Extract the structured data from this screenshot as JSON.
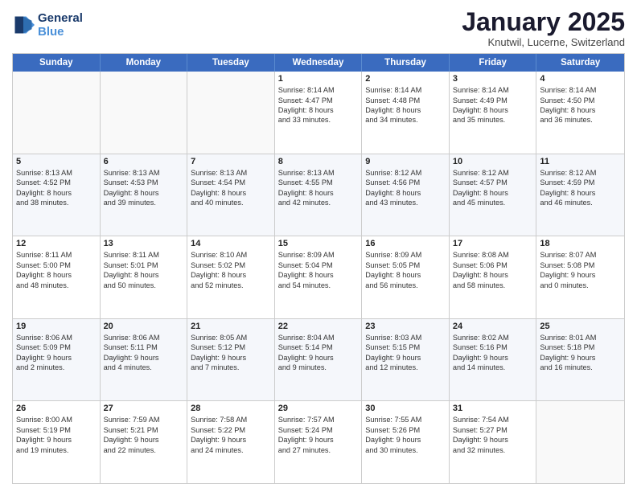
{
  "logo": {
    "line1": "General",
    "line2": "Blue"
  },
  "title": "January 2025",
  "subtitle": "Knutwil, Lucerne, Switzerland",
  "header_days": [
    "Sunday",
    "Monday",
    "Tuesday",
    "Wednesday",
    "Thursday",
    "Friday",
    "Saturday"
  ],
  "weeks": [
    [
      {
        "day": "",
        "lines": []
      },
      {
        "day": "",
        "lines": []
      },
      {
        "day": "",
        "lines": []
      },
      {
        "day": "1",
        "lines": [
          "Sunrise: 8:14 AM",
          "Sunset: 4:47 PM",
          "Daylight: 8 hours",
          "and 33 minutes."
        ]
      },
      {
        "day": "2",
        "lines": [
          "Sunrise: 8:14 AM",
          "Sunset: 4:48 PM",
          "Daylight: 8 hours",
          "and 34 minutes."
        ]
      },
      {
        "day": "3",
        "lines": [
          "Sunrise: 8:14 AM",
          "Sunset: 4:49 PM",
          "Daylight: 8 hours",
          "and 35 minutes."
        ]
      },
      {
        "day": "4",
        "lines": [
          "Sunrise: 8:14 AM",
          "Sunset: 4:50 PM",
          "Daylight: 8 hours",
          "and 36 minutes."
        ]
      }
    ],
    [
      {
        "day": "5",
        "lines": [
          "Sunrise: 8:13 AM",
          "Sunset: 4:52 PM",
          "Daylight: 8 hours",
          "and 38 minutes."
        ]
      },
      {
        "day": "6",
        "lines": [
          "Sunrise: 8:13 AM",
          "Sunset: 4:53 PM",
          "Daylight: 8 hours",
          "and 39 minutes."
        ]
      },
      {
        "day": "7",
        "lines": [
          "Sunrise: 8:13 AM",
          "Sunset: 4:54 PM",
          "Daylight: 8 hours",
          "and 40 minutes."
        ]
      },
      {
        "day": "8",
        "lines": [
          "Sunrise: 8:13 AM",
          "Sunset: 4:55 PM",
          "Daylight: 8 hours",
          "and 42 minutes."
        ]
      },
      {
        "day": "9",
        "lines": [
          "Sunrise: 8:12 AM",
          "Sunset: 4:56 PM",
          "Daylight: 8 hours",
          "and 43 minutes."
        ]
      },
      {
        "day": "10",
        "lines": [
          "Sunrise: 8:12 AM",
          "Sunset: 4:57 PM",
          "Daylight: 8 hours",
          "and 45 minutes."
        ]
      },
      {
        "day": "11",
        "lines": [
          "Sunrise: 8:12 AM",
          "Sunset: 4:59 PM",
          "Daylight: 8 hours",
          "and 46 minutes."
        ]
      }
    ],
    [
      {
        "day": "12",
        "lines": [
          "Sunrise: 8:11 AM",
          "Sunset: 5:00 PM",
          "Daylight: 8 hours",
          "and 48 minutes."
        ]
      },
      {
        "day": "13",
        "lines": [
          "Sunrise: 8:11 AM",
          "Sunset: 5:01 PM",
          "Daylight: 8 hours",
          "and 50 minutes."
        ]
      },
      {
        "day": "14",
        "lines": [
          "Sunrise: 8:10 AM",
          "Sunset: 5:02 PM",
          "Daylight: 8 hours",
          "and 52 minutes."
        ]
      },
      {
        "day": "15",
        "lines": [
          "Sunrise: 8:09 AM",
          "Sunset: 5:04 PM",
          "Daylight: 8 hours",
          "and 54 minutes."
        ]
      },
      {
        "day": "16",
        "lines": [
          "Sunrise: 8:09 AM",
          "Sunset: 5:05 PM",
          "Daylight: 8 hours",
          "and 56 minutes."
        ]
      },
      {
        "day": "17",
        "lines": [
          "Sunrise: 8:08 AM",
          "Sunset: 5:06 PM",
          "Daylight: 8 hours",
          "and 58 minutes."
        ]
      },
      {
        "day": "18",
        "lines": [
          "Sunrise: 8:07 AM",
          "Sunset: 5:08 PM",
          "Daylight: 9 hours",
          "and 0 minutes."
        ]
      }
    ],
    [
      {
        "day": "19",
        "lines": [
          "Sunrise: 8:06 AM",
          "Sunset: 5:09 PM",
          "Daylight: 9 hours",
          "and 2 minutes."
        ]
      },
      {
        "day": "20",
        "lines": [
          "Sunrise: 8:06 AM",
          "Sunset: 5:11 PM",
          "Daylight: 9 hours",
          "and 4 minutes."
        ]
      },
      {
        "day": "21",
        "lines": [
          "Sunrise: 8:05 AM",
          "Sunset: 5:12 PM",
          "Daylight: 9 hours",
          "and 7 minutes."
        ]
      },
      {
        "day": "22",
        "lines": [
          "Sunrise: 8:04 AM",
          "Sunset: 5:14 PM",
          "Daylight: 9 hours",
          "and 9 minutes."
        ]
      },
      {
        "day": "23",
        "lines": [
          "Sunrise: 8:03 AM",
          "Sunset: 5:15 PM",
          "Daylight: 9 hours",
          "and 12 minutes."
        ]
      },
      {
        "day": "24",
        "lines": [
          "Sunrise: 8:02 AM",
          "Sunset: 5:16 PM",
          "Daylight: 9 hours",
          "and 14 minutes."
        ]
      },
      {
        "day": "25",
        "lines": [
          "Sunrise: 8:01 AM",
          "Sunset: 5:18 PM",
          "Daylight: 9 hours",
          "and 16 minutes."
        ]
      }
    ],
    [
      {
        "day": "26",
        "lines": [
          "Sunrise: 8:00 AM",
          "Sunset: 5:19 PM",
          "Daylight: 9 hours",
          "and 19 minutes."
        ]
      },
      {
        "day": "27",
        "lines": [
          "Sunrise: 7:59 AM",
          "Sunset: 5:21 PM",
          "Daylight: 9 hours",
          "and 22 minutes."
        ]
      },
      {
        "day": "28",
        "lines": [
          "Sunrise: 7:58 AM",
          "Sunset: 5:22 PM",
          "Daylight: 9 hours",
          "and 24 minutes."
        ]
      },
      {
        "day": "29",
        "lines": [
          "Sunrise: 7:57 AM",
          "Sunset: 5:24 PM",
          "Daylight: 9 hours",
          "and 27 minutes."
        ]
      },
      {
        "day": "30",
        "lines": [
          "Sunrise: 7:55 AM",
          "Sunset: 5:26 PM",
          "Daylight: 9 hours",
          "and 30 minutes."
        ]
      },
      {
        "day": "31",
        "lines": [
          "Sunrise: 7:54 AM",
          "Sunset: 5:27 PM",
          "Daylight: 9 hours",
          "and 32 minutes."
        ]
      },
      {
        "day": "",
        "lines": []
      }
    ]
  ]
}
